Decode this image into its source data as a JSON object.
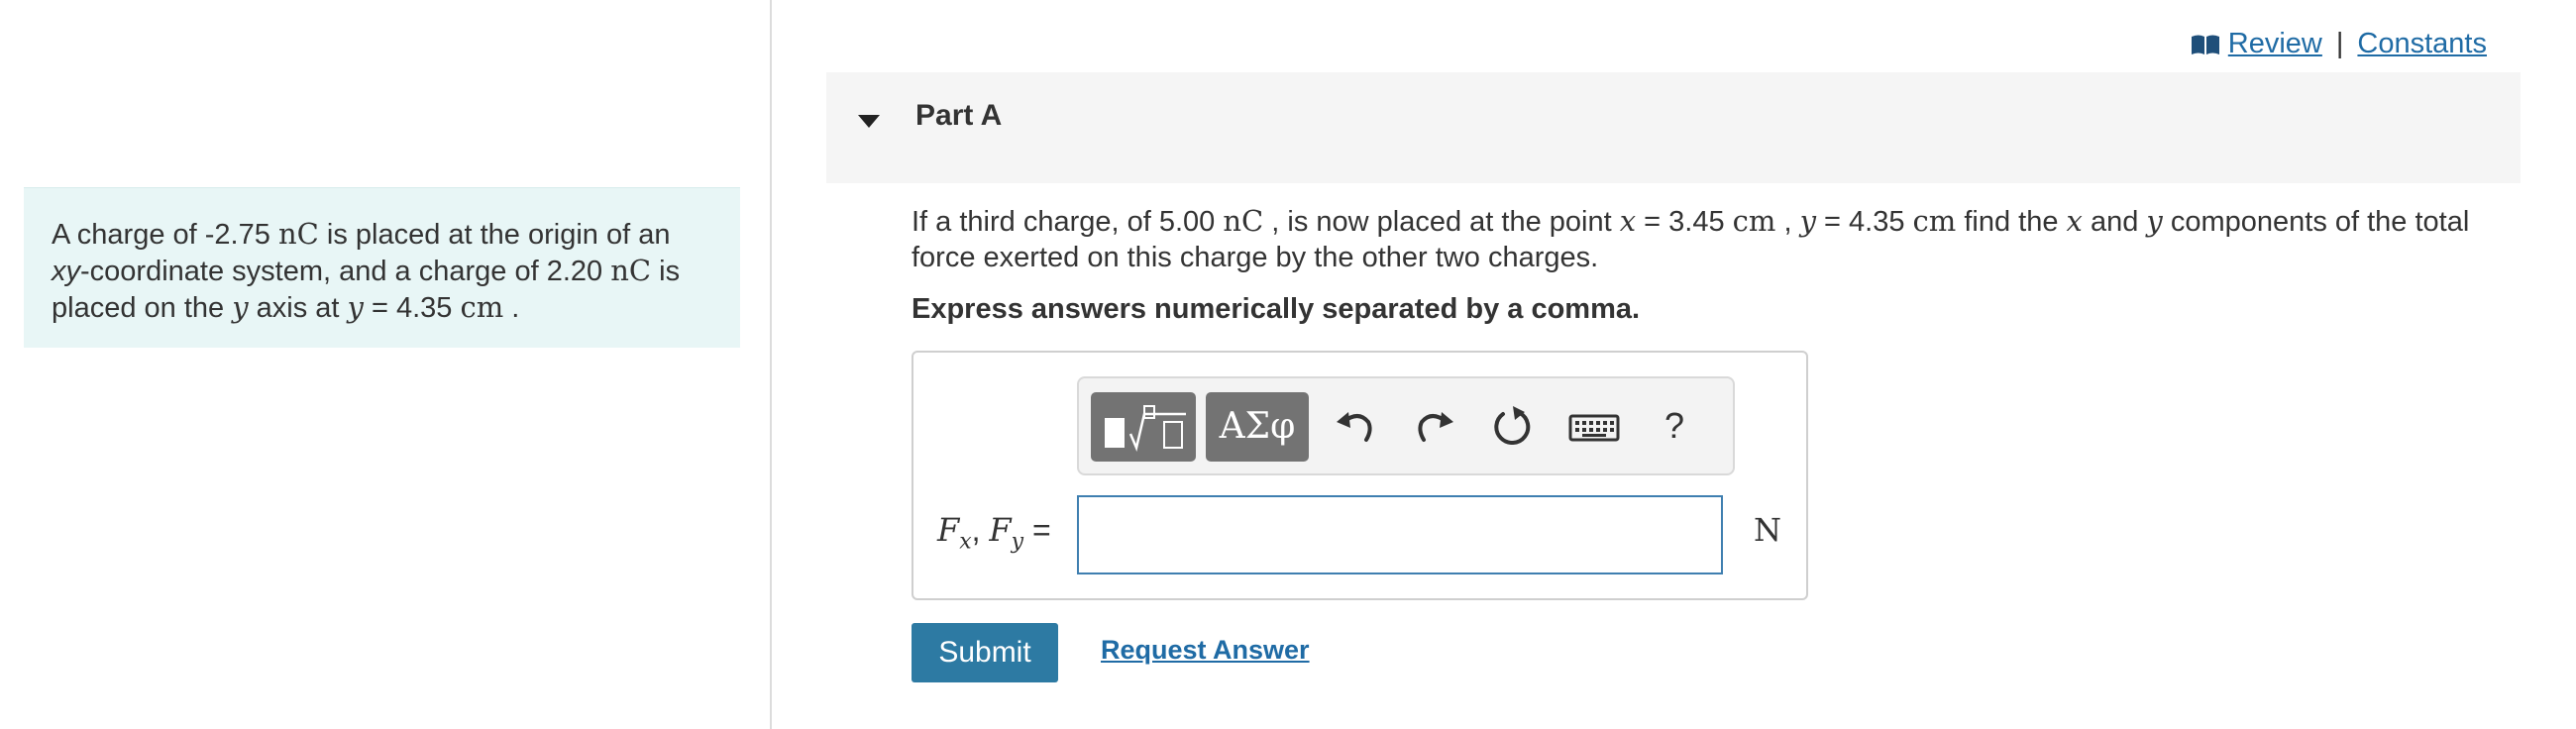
{
  "intro": {
    "a": "A charge of -2.75 ",
    "unit1": "nC",
    "b": " is placed at the origin of an ",
    "xy": "xy",
    "c": "-coordinate system, and a charge of 2.20 ",
    "unit2": "nC",
    "d": " is placed on the ",
    "var_y": "y",
    "e": " axis at ",
    "var_y2": "y",
    "f": " = 4.35 ",
    "unit3": "cm",
    "g": " ."
  },
  "top_links": {
    "review": "Review",
    "separator": "|",
    "constants": "Constants"
  },
  "part": {
    "title": "Part A"
  },
  "question": {
    "a": "If a third charge, of 5.00 ",
    "unit1": "nC",
    "b": " , is now placed at the point ",
    "var_x": "x",
    "c": " = 3.45 ",
    "unit2": "cm",
    "d": " , ",
    "var_y": "y",
    "e": " = 4.35 ",
    "unit3": "cm",
    "f": " find the ",
    "var_x2": "x",
    "g": " and ",
    "var_y2": "y",
    "h": " components of the total force exerted on this charge by the other two charges."
  },
  "instruction": "Express answers numerically separated by a comma.",
  "toolbar": {
    "greek_label": "ΑΣφ",
    "help_label": "?"
  },
  "answer": {
    "label_F": "F",
    "sub_x": "x",
    "comma": ", ",
    "sub_y": "y",
    "equals": " =",
    "value": "",
    "unit": "N"
  },
  "actions": {
    "submit": "Submit",
    "request_answer": "Request Answer"
  },
  "colors": {
    "accent": "#2d7aa3",
    "link": "#1f6ba5",
    "intro_bg": "#e8f6f6",
    "toolbar_button": "#737373"
  }
}
